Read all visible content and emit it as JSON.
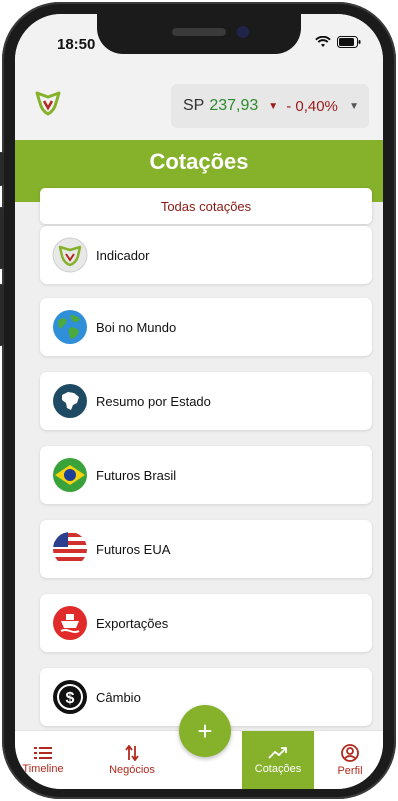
{
  "status": {
    "time": "18:50"
  },
  "header": {
    "ticker_symbol": "SP",
    "ticker_price": "237,93",
    "ticker_change": "- 0,40%"
  },
  "page_title": "Cotações",
  "tab_label": "Todas cotações",
  "items": [
    {
      "label": "Indicador",
      "icon": "indicador-logo-icon"
    },
    {
      "label": "Boi no Mundo",
      "icon": "globe-icon"
    },
    {
      "label": "Resumo por Estado",
      "icon": "brazil-map-icon"
    },
    {
      "label": "Futuros Brasil",
      "icon": "brazil-flag-icon"
    },
    {
      "label": "Futuros EUA",
      "icon": "usa-flag-icon"
    },
    {
      "label": "Exportações",
      "icon": "ship-icon"
    },
    {
      "label": "Câmbio",
      "icon": "dollar-icon"
    }
  ],
  "nav": {
    "timeline": "Timeline",
    "negocios": "Negócios",
    "cotacoes": "Cotações",
    "perfil": "Perfil",
    "fab": "+"
  },
  "colors": {
    "brand_green": "#86b12a",
    "accent_red": "#b22a1f",
    "price_green": "#2d8a2d"
  }
}
